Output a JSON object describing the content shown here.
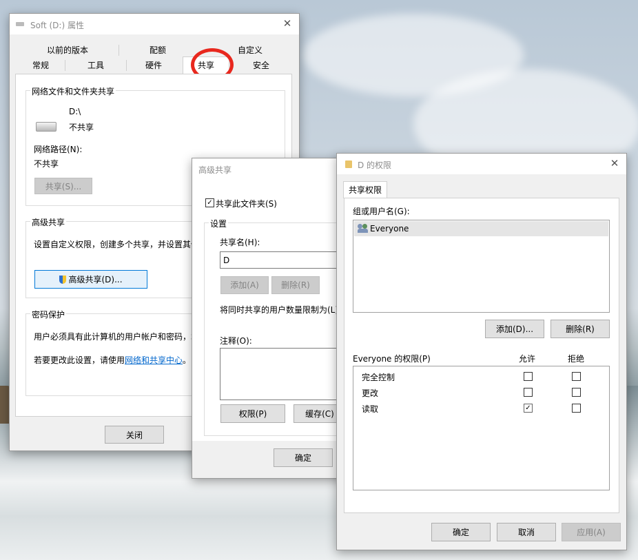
{
  "props": {
    "title": "Soft (D:) 属性",
    "tabs_row1": [
      "以前的版本",
      "配额",
      "自定义"
    ],
    "tabs_row2": [
      "常规",
      "工具",
      "硬件",
      "共享",
      "安全"
    ],
    "net_group": "网络文件和文件夹共享",
    "drive_path": "D:\\",
    "drive_status": "不共享",
    "net_path_label": "网络路径(N):",
    "net_path_value": "不共享",
    "share_btn": "共享(S)...",
    "adv_group": "高级共享",
    "adv_desc": "设置自定义权限，创建多个共享，并设置其他",
    "adv_btn": "高级共享(D)...",
    "pwd_group": "密码保护",
    "pwd_desc": "用户必须具有此计算机的用户帐户和密码，才",
    "pwd_change_prefix": "若要更改此设置，请使用",
    "pwd_link": "网络和共享中心",
    "pwd_change_suffix": "。",
    "close_btn": "关闭"
  },
  "adv": {
    "title": "高级共享",
    "share_check": "共享此文件夹(S)",
    "settings_group": "设置",
    "share_name_label": "共享名(H):",
    "share_name_value": "D",
    "add_btn": "添加(A)",
    "remove_btn": "删除(R)",
    "limit_label": "将同时共享的用户数量限制为(L)",
    "comment_label": "注释(O):",
    "perm_btn": "权限(P)",
    "cache_btn": "缓存(C)",
    "ok_btn": "确定"
  },
  "perm": {
    "title": "D 的权限",
    "tab": "共享权限",
    "group_label": "组或用户名(G):",
    "users": [
      "Everyone"
    ],
    "add_btn": "添加(D)...",
    "remove_btn": "删除(R)",
    "perm_header": "Everyone 的权限(P)",
    "allow_header": "允许",
    "deny_header": "拒绝",
    "rows": [
      {
        "name": "完全控制",
        "allow": false,
        "deny": false
      },
      {
        "name": "更改",
        "allow": false,
        "deny": false
      },
      {
        "name": "读取",
        "allow": true,
        "deny": false
      }
    ],
    "ok_btn": "确定",
    "cancel_btn": "取消",
    "apply_btn": "应用(A)"
  },
  "colors": {
    "annotation_circle": "#e8281e",
    "link": "#0066cc",
    "focus": "#0078d7"
  }
}
